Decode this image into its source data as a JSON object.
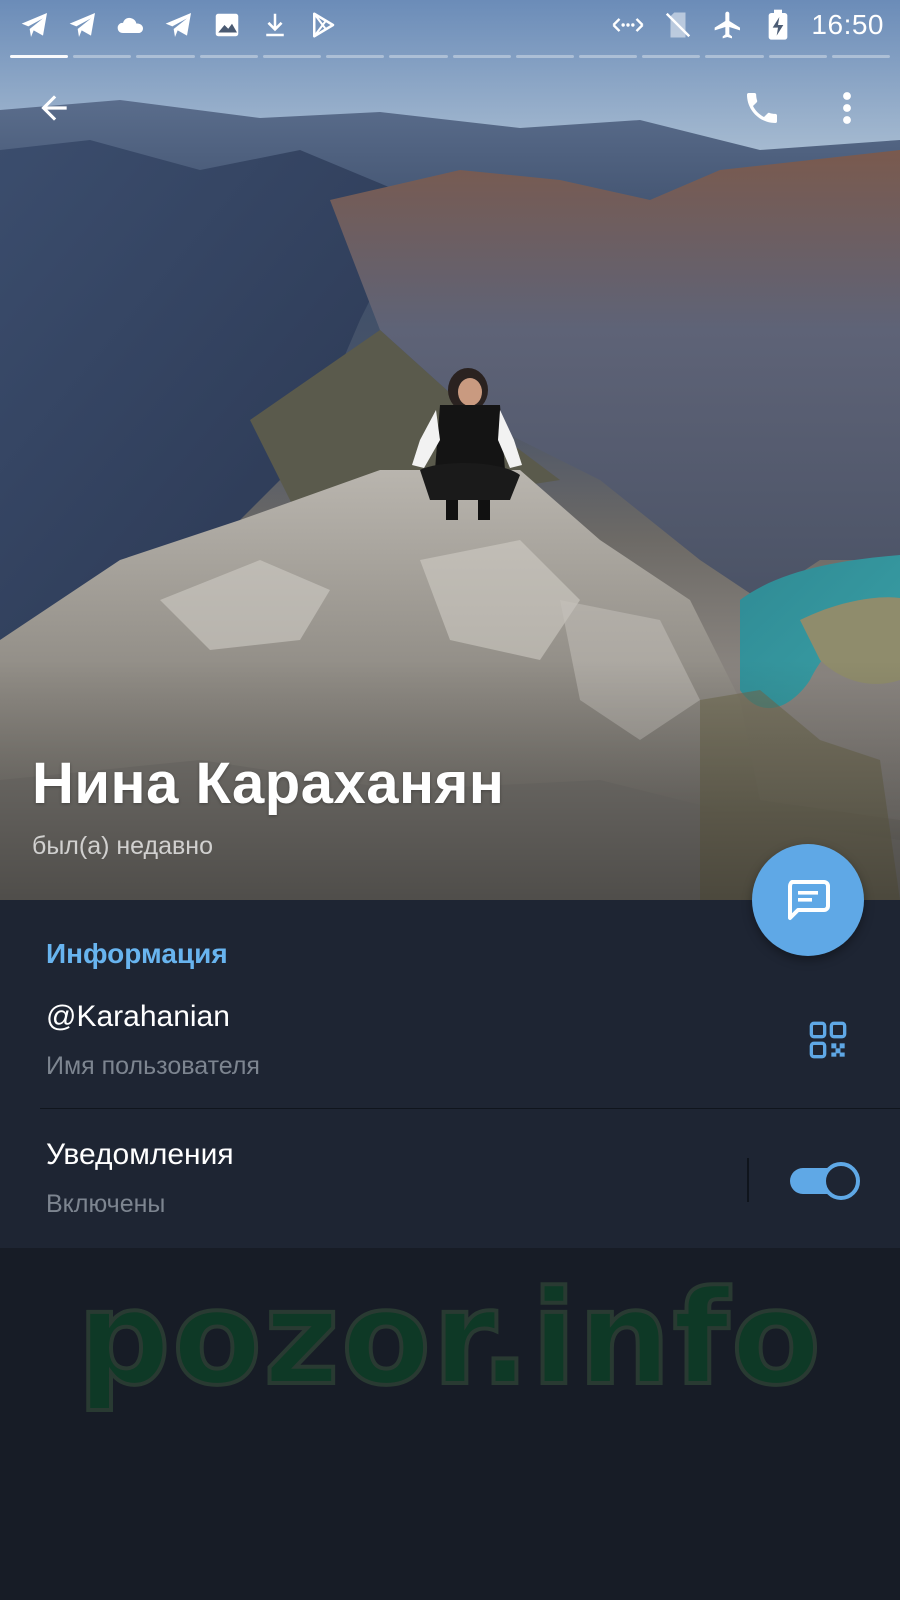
{
  "status_bar": {
    "time": "16:50",
    "left_icons": [
      "telegram-icon",
      "telegram-icon",
      "cloud-icon",
      "telegram-icon",
      "image-icon",
      "download-icon",
      "play-store-icon"
    ],
    "right_icons": [
      "data-transfer-icon",
      "no-sim-icon",
      "airplane-mode-icon",
      "battery-charging-icon"
    ]
  },
  "story": {
    "segment_count": 14,
    "active_segment": 1
  },
  "profile": {
    "name": "Нина Караханян",
    "status": "был(а) недавно"
  },
  "info": {
    "section_title": "Информация",
    "username": "@Karahanian",
    "username_label": "Имя пользователя",
    "notifications_title": "Уведомления",
    "notifications_value": "Включены",
    "notifications_enabled": true
  },
  "watermark": "pozor.info",
  "colors": {
    "accent": "#5fa8e6",
    "section_title": "#68b4ef",
    "panel_bg": "#1e2533",
    "page_bg": "#171c26",
    "secondary_text": "#7d8590"
  }
}
